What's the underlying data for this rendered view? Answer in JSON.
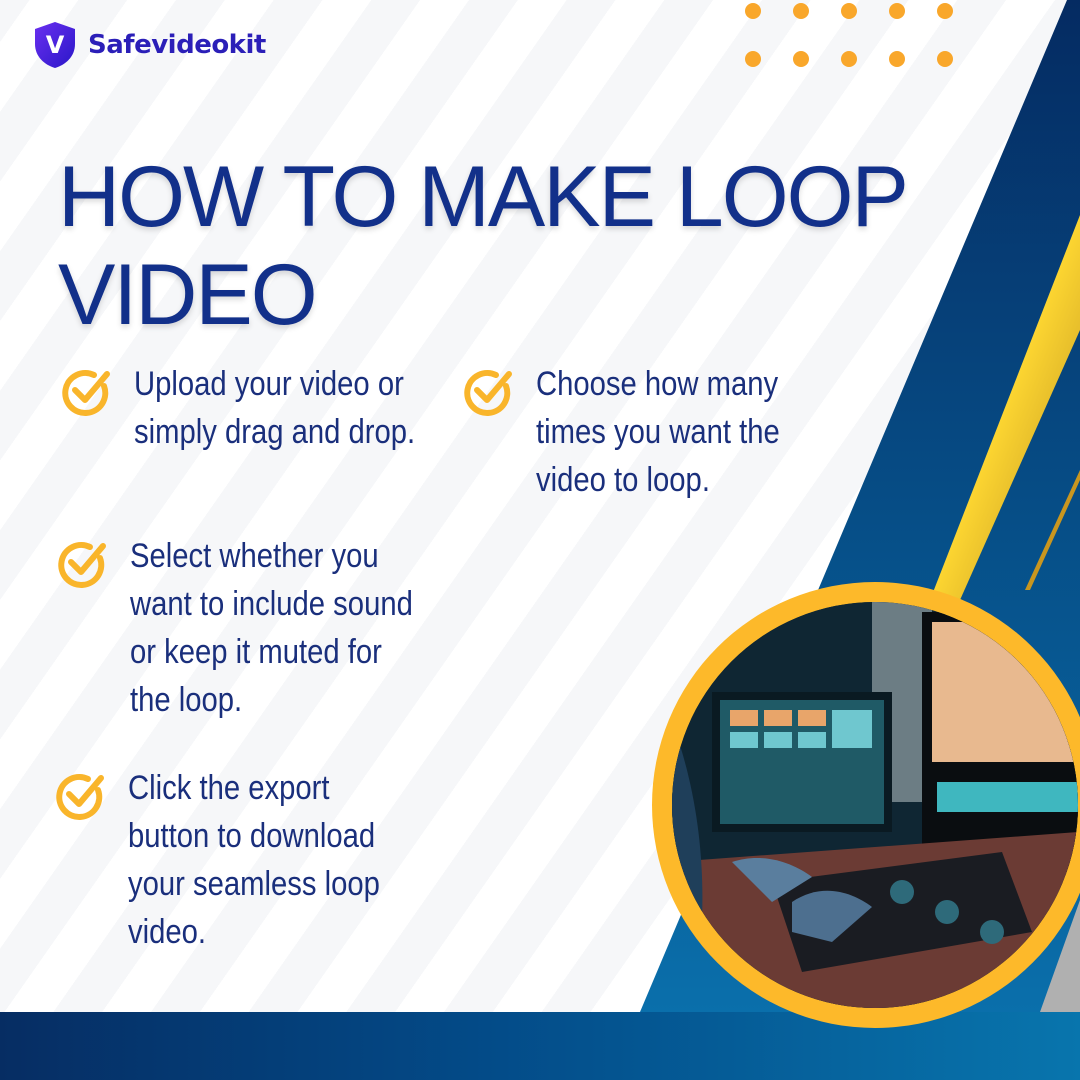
{
  "brand": {
    "name": "Safevideokit",
    "logo_letter": "V",
    "primary_color": "#2b1fb8",
    "accent_color": "#f9a72b",
    "navy": "#0a3d73"
  },
  "title": "HOW TO MAKE LOOP VIDEO",
  "steps": [
    {
      "text": "Upload your video or simply drag and drop."
    },
    {
      "text": "Choose how many times you want the video to loop."
    },
    {
      "text": "Select whether you want to include sound or keep it muted for the loop."
    },
    {
      "text": "Click the export button to download your seamless loop video."
    }
  ],
  "photo": {
    "subject": "video-editor-workstation"
  }
}
